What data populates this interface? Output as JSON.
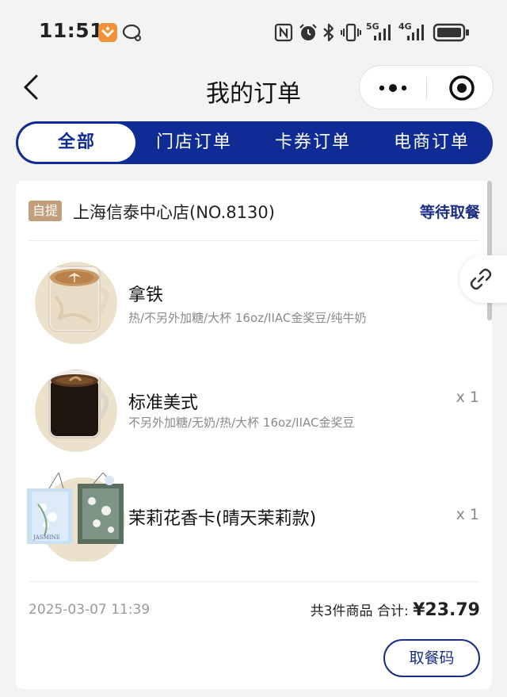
{
  "status_bar": {
    "time": "11:51",
    "signal_5g": "5G",
    "signal_4g": "4G"
  },
  "nav": {
    "title": "我的订单"
  },
  "tabs": [
    {
      "label": "全部",
      "active": true
    },
    {
      "label": "门店订单",
      "active": false
    },
    {
      "label": "卡券订单",
      "active": false
    },
    {
      "label": "电商订单",
      "active": false
    }
  ],
  "order": {
    "badge": "自提",
    "store": "上海信泰中心店(NO.8130)",
    "status": "等待取餐",
    "items": [
      {
        "name": "拿铁",
        "desc": "热/不另外加糖/大杯 16oz/IIAC金奖豆/纯牛奶",
        "qty": ""
      },
      {
        "name": "标准美式",
        "desc": "不另外加糖/无奶/热/大杯 16oz/IIAC金奖豆",
        "qty": "x 1"
      },
      {
        "name": "茉莉花香卡(晴天茉莉款)",
        "desc": "",
        "qty": "x 1",
        "card_text": "JASMINE"
      }
    ],
    "datetime": "2025-03-07 11:39",
    "summary_label": "共3件商品 合计:",
    "total": "¥23.79",
    "pickup_button": "取餐码"
  },
  "colors": {
    "brand": "#0f2b94",
    "badge": "#c29e7b"
  }
}
